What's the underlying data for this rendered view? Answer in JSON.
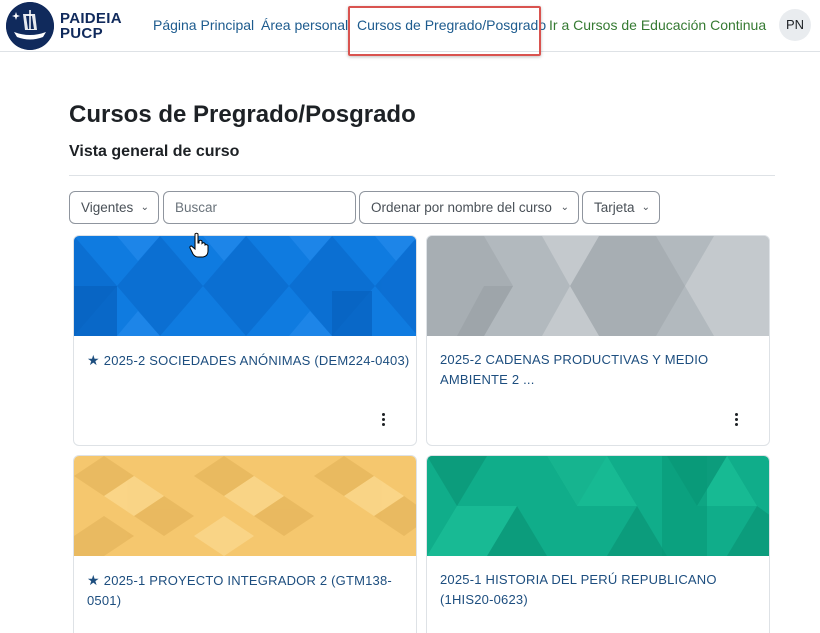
{
  "brand": {
    "line1": "PAIDEIA",
    "line2": "PUCP"
  },
  "nav": {
    "home": "Página Principal",
    "personal": "Área personal",
    "courses": "Cursos de Pregrado/Posgrado",
    "continuing": "Ir a Cursos de Educación Continua",
    "avatar_initials": "PN"
  },
  "page": {
    "title": "Cursos de Pregrado/Posgrado",
    "section": "Vista general de curso"
  },
  "filters": {
    "status": "Vigentes",
    "search_placeholder": "Buscar",
    "sort": "Ordenar por nombre del curso",
    "view": "Tarjeta"
  },
  "courses": [
    {
      "title": "2025-2 SOCIEDADES ANÓNIMAS (DEM224-0403)",
      "starred": true,
      "color": "#0f7be0"
    },
    {
      "title": "2025-2 CADENAS PRODUCTIVAS Y MEDIO AMBIENTE 2 ...",
      "starred": false,
      "color": "#b2b9be"
    },
    {
      "title": "2025-1 PROYECTO INTEGRADOR 2 (GTM138-0501)",
      "starred": true,
      "color": "#f5c76e"
    },
    {
      "title": "2025-1 HISTORIA DEL PERÚ REPUBLICANO (1HIS20-0623)",
      "starred": false,
      "color": "#10ad8a"
    }
  ],
  "colors": {
    "link": "#0f6cbf",
    "brand": "#102a5c",
    "highlight": "#d9534f"
  }
}
